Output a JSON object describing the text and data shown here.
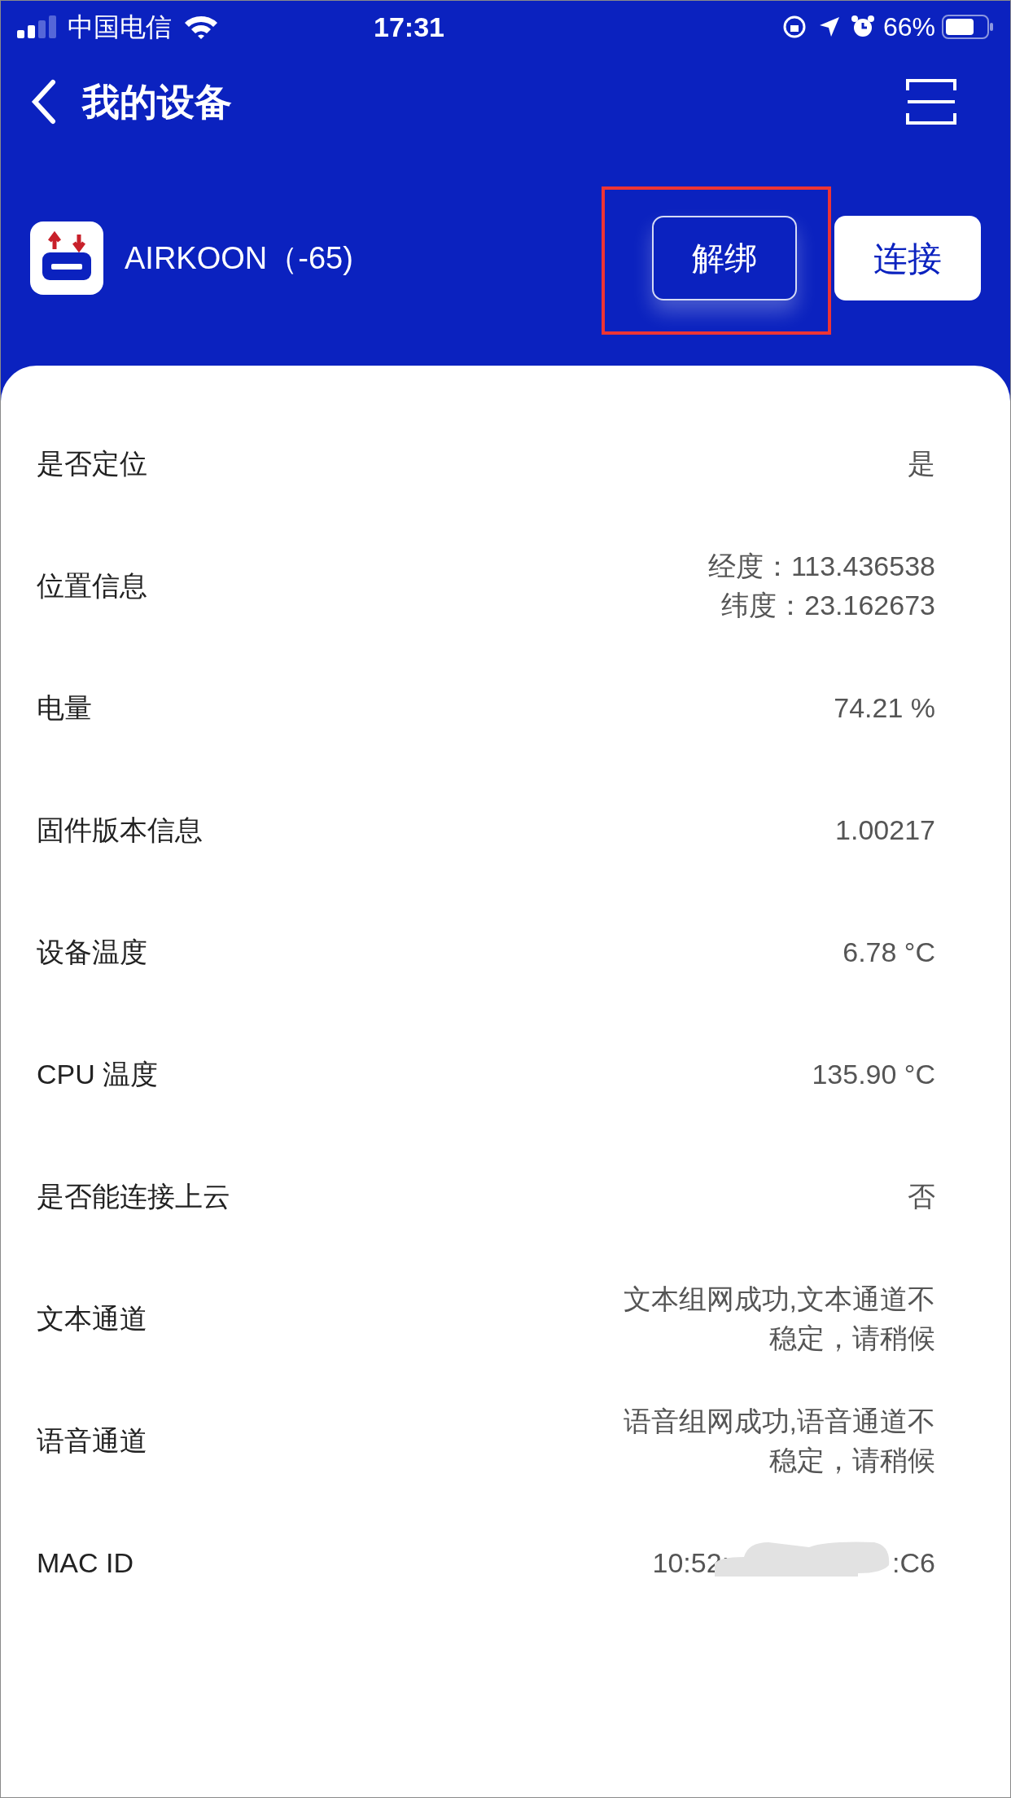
{
  "status_bar": {
    "carrier": "中国电信",
    "time": "17:31",
    "battery": "66%"
  },
  "header": {
    "title": "我的设备"
  },
  "device": {
    "name": "AIRKOON（-65)",
    "unbind_button": "解绑",
    "connect_button": "连接",
    "unbind_highlighted": true
  },
  "rows": [
    {
      "label": "是否定位",
      "values": [
        "是"
      ]
    },
    {
      "label": "位置信息",
      "values": [
        "经度：113.436538",
        "纬度：23.162673"
      ]
    },
    {
      "label": "电量",
      "values": [
        "74.21 %"
      ]
    },
    {
      "label": "固件版本信息",
      "values": [
        "1.00217"
      ]
    },
    {
      "label": "设备温度",
      "values": [
        "6.78 °C"
      ]
    },
    {
      "label": "CPU 温度",
      "values": [
        "135.90 °C"
      ]
    },
    {
      "label": "是否能连接上云",
      "values": [
        "否"
      ]
    },
    {
      "label": "文本通道",
      "values": [
        "文本组网成功,文本通道不",
        "稳定，请稍候"
      ]
    },
    {
      "label": "语音通道",
      "values": [
        "语音组网成功,语音通道不",
        "稳定，请稍候"
      ]
    },
    {
      "label": "MAC ID",
      "kind": "redacted",
      "values": [
        "10:52:",
        ":C6"
      ]
    }
  ]
}
